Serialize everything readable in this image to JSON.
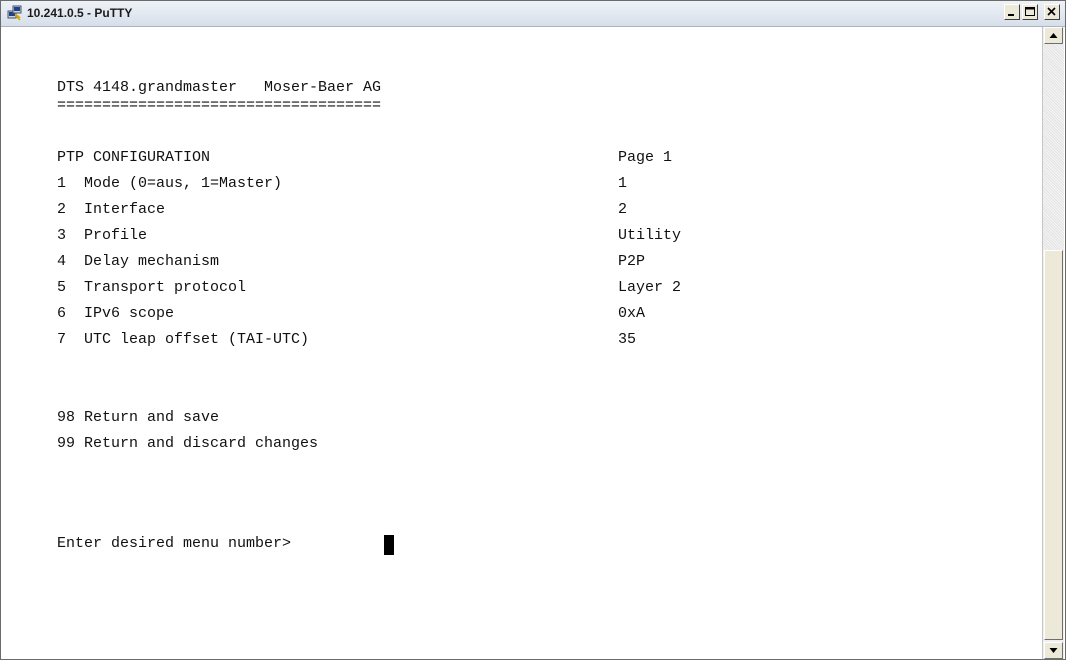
{
  "window": {
    "title": "10.241.0.5 - PuTTY",
    "app_icon": "putty-icon"
  },
  "terminal": {
    "header": "DTS 4148.grandmaster   Moser-Baer AG",
    "separator": "====================================",
    "section_title": "PTP CONFIGURATION",
    "page_label": "Page 1",
    "menu": [
      {
        "label": "1  Mode (0=aus, 1=Master)",
        "value": "1"
      },
      {
        "label": "2  Interface",
        "value": "2"
      },
      {
        "label": "3  Profile",
        "value": "Utility"
      },
      {
        "label": "4  Delay mechanism",
        "value": "P2P"
      },
      {
        "label": "5  Transport protocol",
        "value": "Layer 2"
      },
      {
        "label": "6  IPv6 scope",
        "value": "0xA"
      },
      {
        "label": "7  UTC leap offset (TAI-UTC)",
        "value": "35"
      }
    ],
    "actions": [
      {
        "label": "98 Return and save"
      },
      {
        "label": "99 Return and discard changes"
      }
    ],
    "prompt": "Enter desired menu number>"
  },
  "colors": {
    "background": "#ffffff",
    "text": "#111111",
    "titlebar": "#dfe6ef"
  }
}
